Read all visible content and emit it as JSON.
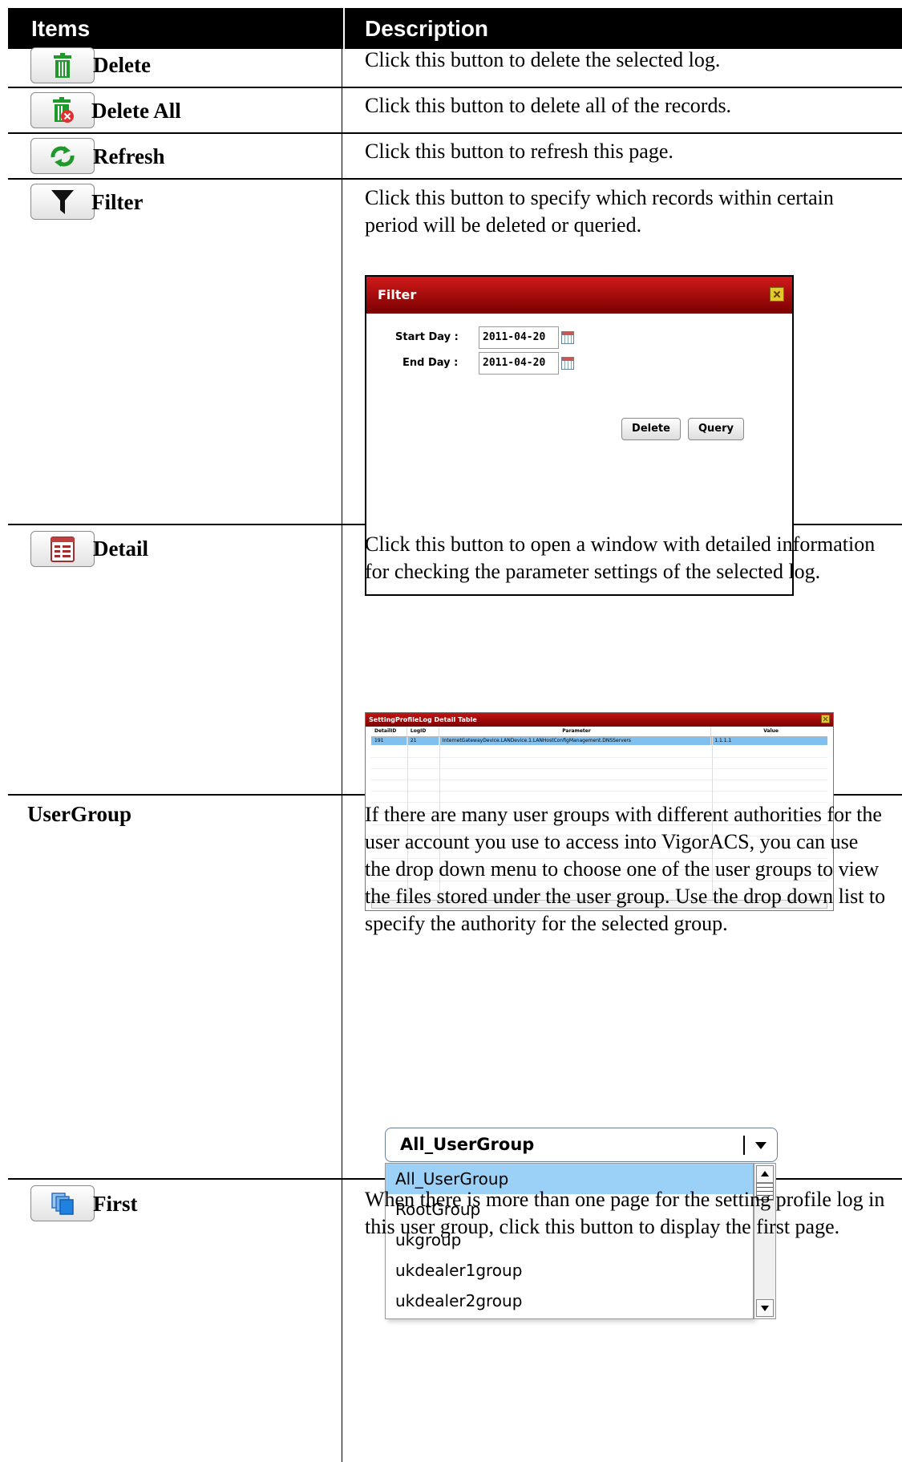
{
  "table": {
    "header_items": "Items",
    "header_description": "Description"
  },
  "rows": {
    "delete": {
      "label": "Delete",
      "icon": "trash-icon",
      "description": "Click this button to delete the selected log."
    },
    "delete_all": {
      "label": "Delete All",
      "icon": "trash-all-icon",
      "description": "Click this button to delete all of the records."
    },
    "refresh": {
      "label": "Refresh",
      "icon": "refresh-icon",
      "description": "Click this button to refresh this page."
    },
    "filter": {
      "label": "Filter",
      "icon": "funnel-icon",
      "description": "Click this button to specify which records within certain period will be deleted or queried."
    },
    "detail": {
      "label": "Detail",
      "icon": "detail-list-icon",
      "description": "Click this button to open a window with detailed information for checking the parameter settings of the selected log."
    },
    "usergroup": {
      "label": "UserGroup",
      "description": "If there are many user groups with different authorities for the user account you use to access into VigorACS, you can use the drop down menu to choose one of the user groups to view the files stored under the user group. Use the drop down list to specify the authority for the selected group."
    },
    "first": {
      "label": "First",
      "icon": "first-page-icon",
      "description": "When there is more than one page for the setting profile log in this user group, click this button to display the first page."
    }
  },
  "filter_dialog": {
    "title": "Filter",
    "start_label": "Start Day :",
    "start_value": "2011-04-20",
    "end_label": "End Day :",
    "end_value": "2011-04-20",
    "delete_button": "Delete",
    "query_button": "Query"
  },
  "detail_window": {
    "title": "SettingProfileLog Detail Table",
    "columns": [
      "DetailID",
      "LogID",
      "Parameter",
      "Value"
    ],
    "row": [
      "191",
      "21",
      "InternetGatewayDevice.LANDevice.1.LANHostConfigManagement.DNSServers",
      "1.1.1.1"
    ]
  },
  "usergroup_dropdown": {
    "selected": "All_UserGroup",
    "options": [
      "All_UserGroup",
      "RootGroup",
      "ukgroup",
      "ukdealer1group",
      "ukdealer2group"
    ]
  },
  "colors": {
    "header_bg": "#000000",
    "dialog_title": "#b00000",
    "selected_option": "#9bd0f7"
  }
}
